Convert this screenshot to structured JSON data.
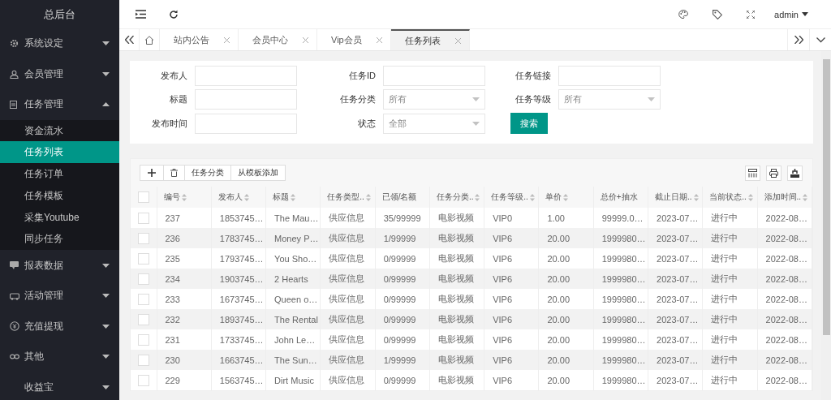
{
  "sidebar": {
    "title": "总后台",
    "items": [
      {
        "label": "系统设定",
        "expanded": false
      },
      {
        "label": "会员管理",
        "expanded": false
      },
      {
        "label": "任务管理",
        "expanded": true,
        "children": [
          {
            "label": "资金流水",
            "selected": false
          },
          {
            "label": "任务列表",
            "selected": true
          },
          {
            "label": "任务订单",
            "selected": false
          },
          {
            "label": "任务模板",
            "selected": false
          },
          {
            "label": "采集Youtube",
            "selected": false
          },
          {
            "label": "同步任务",
            "selected": false
          }
        ]
      },
      {
        "label": "报表数据",
        "expanded": false
      },
      {
        "label": "活动管理",
        "expanded": false
      },
      {
        "label": "充值提现",
        "expanded": false
      },
      {
        "label": "其他",
        "expanded": false
      },
      {
        "label": "收益宝",
        "expanded": false
      }
    ]
  },
  "header": {
    "user": "admin"
  },
  "tabs": [
    {
      "label": "站内公告",
      "selected": false
    },
    {
      "label": "会员中心",
      "selected": false
    },
    {
      "label": "Vip会员",
      "selected": false
    },
    {
      "label": "任务列表",
      "selected": true
    }
  ],
  "search": {
    "fields": [
      {
        "label": "发布人",
        "kind": "text"
      },
      {
        "label": "任务ID",
        "kind": "text"
      },
      {
        "label": "任务链接",
        "kind": "text"
      },
      {
        "label": "标题",
        "kind": "text"
      },
      {
        "label": "任务分类",
        "kind": "select",
        "value": "所有"
      },
      {
        "label": "任务等级",
        "kind": "select",
        "value": "所有"
      },
      {
        "label": "发布时间",
        "kind": "text"
      },
      {
        "label": "状态",
        "kind": "select",
        "value": "全部"
      }
    ],
    "button": "搜索"
  },
  "toolbar": {
    "buttons": [
      "任务分类",
      "从模板添加"
    ]
  },
  "table": {
    "all_checked": false,
    "columns": [
      {
        "label": "编号",
        "sortable": true
      },
      {
        "label": "发布人",
        "sortable": true
      },
      {
        "label": "标题",
        "sortable": true
      },
      {
        "label": "任务类型..",
        "sortable": true
      },
      {
        "label": "已领/名额",
        "sortable": false
      },
      {
        "label": "任务分类..",
        "sortable": true
      },
      {
        "label": "任务等级..",
        "sortable": true
      },
      {
        "label": "单价",
        "sortable": true
      },
      {
        "label": "总价+抽水",
        "sortable": false
      },
      {
        "label": "截止日期..",
        "sortable": true
      },
      {
        "label": "当前状态..",
        "sortable": true
      },
      {
        "label": "添加时间..",
        "sortable": true
      }
    ],
    "rows": [
      {
        "checked": false,
        "cells": [
          "237",
          "1853745…",
          "The Mau…",
          "供应信息",
          "35/99999",
          "电影视频",
          "VIP0",
          "1.00",
          "99999.0…",
          "2023-07…",
          "进行中",
          "2022-08…"
        ]
      },
      {
        "checked": false,
        "cells": [
          "236",
          "1783745…",
          "Money P…",
          "供应信息",
          "1/99999",
          "电影视频",
          "VIP6",
          "20.00",
          "1999980…",
          "2023-07…",
          "进行中",
          "2022-08…"
        ]
      },
      {
        "checked": false,
        "cells": [
          "235",
          "1793745…",
          "You Sho…",
          "供应信息",
          "0/99999",
          "电影视频",
          "VIP6",
          "20.00",
          "1999980…",
          "2023-07…",
          "进行中",
          "2022-08…"
        ]
      },
      {
        "checked": false,
        "cells": [
          "234",
          "1903745…",
          "2 Hearts",
          "供应信息",
          "0/99999",
          "电影视频",
          "VIP6",
          "20.00",
          "1999980…",
          "2023-07…",
          "进行中",
          "2022-08…"
        ]
      },
      {
        "checked": false,
        "cells": [
          "233",
          "1673745…",
          "Queen o…",
          "供应信息",
          "0/99999",
          "电影视频",
          "VIP6",
          "20.00",
          "1999980…",
          "2023-07…",
          "进行中",
          "2022-08…"
        ]
      },
      {
        "checked": false,
        "cells": [
          "232",
          "1893745…",
          "The Rental",
          "供应信息",
          "0/99999",
          "电影视频",
          "VIP6",
          "20.00",
          "1999980…",
          "2023-07…",
          "进行中",
          "2022-08…"
        ]
      },
      {
        "checked": false,
        "cells": [
          "231",
          "1733745…",
          "John Le…",
          "供应信息",
          "0/99999",
          "电影视频",
          "VIP6",
          "20.00",
          "1999980…",
          "2023-07…",
          "进行中",
          "2022-08…"
        ]
      },
      {
        "checked": false,
        "cells": [
          "230",
          "1663745…",
          "The Sun…",
          "供应信息",
          "1/99999",
          "电影视频",
          "VIP6",
          "20.00",
          "1999980…",
          "2023-07…",
          "进行中",
          "2022-08…"
        ]
      },
      {
        "checked": false,
        "cells": [
          "229",
          "1563745…",
          "Dirt Music",
          "供应信息",
          "0/99999",
          "电影视频",
          "VIP6",
          "20.00",
          "1999980…",
          "2023-07…",
          "进行中",
          "2022-08…"
        ]
      }
    ]
  }
}
